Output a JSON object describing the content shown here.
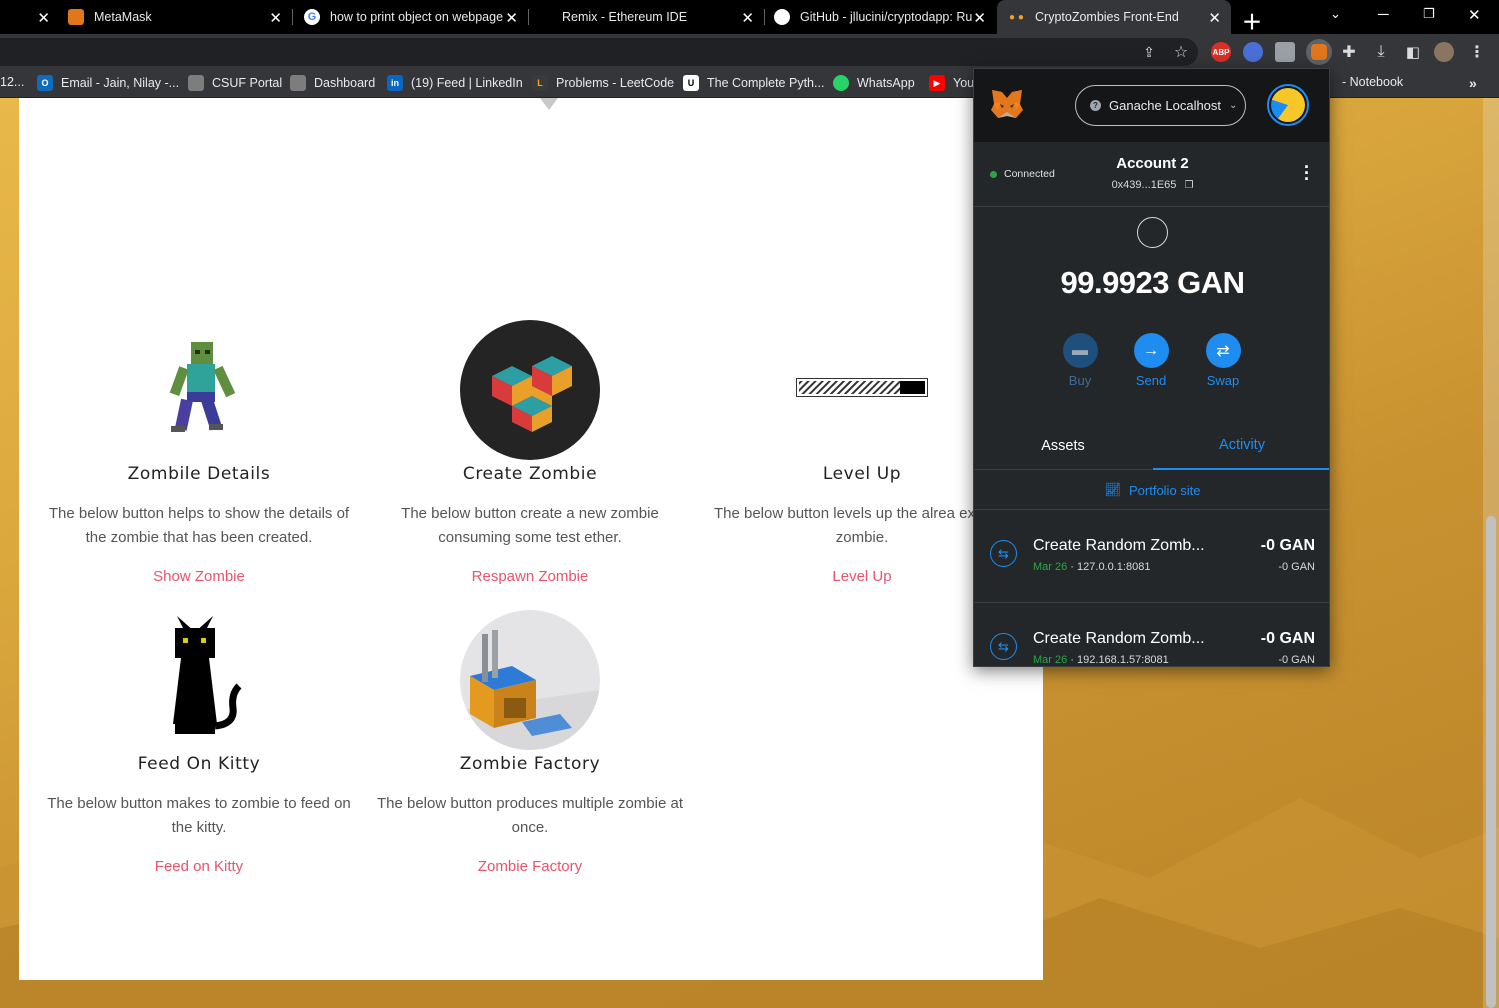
{
  "tabs": [
    {
      "title": "MetaMask",
      "active": false
    },
    {
      "title": "how to print object on webpage",
      "active": false
    },
    {
      "title": "Remix - Ethereum IDE",
      "active": false
    },
    {
      "title": "GitHub - jllucini/cryptodapp: Ru",
      "active": false
    },
    {
      "title": "CryptoZombies Front-End",
      "active": true
    }
  ],
  "bookmarks": [
    {
      "label": "12...",
      "icon": "bookmark-icon"
    },
    {
      "label": "Email - Jain, Nilay -...",
      "icon": "outlook-icon"
    },
    {
      "label": "CSUF Portal",
      "icon": "csuf-icon"
    },
    {
      "label": "Dashboard",
      "icon": "csuf-icon"
    },
    {
      "label": "(19) Feed | LinkedIn",
      "icon": "linkedin-icon"
    },
    {
      "label": "Problems - LeetCode",
      "icon": "leetcode-icon"
    },
    {
      "label": "The Complete Pyth...",
      "icon": "udemy-icon"
    },
    {
      "label": "WhatsApp",
      "icon": "whatsapp-icon"
    },
    {
      "label": "You",
      "icon": "youtube-icon"
    },
    {
      "label": "- Notebook",
      "icon": "notebook-icon"
    }
  ],
  "features": [
    {
      "title": "Zombile Details",
      "desc": "The below button helps to show the details of the zombie that has been created.",
      "link": "Show Zombie"
    },
    {
      "title": "Create Zombie",
      "desc": "The below button create a new zombie consuming some test ether.",
      "link": "Respawn Zombie"
    },
    {
      "title": "Level Up",
      "desc": "The below button levels up the alrea existing zombie.",
      "link": "Level Up"
    },
    {
      "title": "Feed On Kitty",
      "desc": "The below button makes to zombie to feed on the kitty.",
      "link": "Feed on Kitty"
    },
    {
      "title": "Zombie Factory",
      "desc": "The below button produces multiple zombie at once.",
      "link": "Zombie Factory"
    }
  ],
  "metamask": {
    "network": "Ganache Localhost",
    "network_icon": "?",
    "status": "Connected",
    "account_name": "Account 2",
    "account_address": "0x439...1E65",
    "balance": "99.9923 GAN",
    "actions": {
      "buy": "Buy",
      "send": "Send",
      "swap": "Swap"
    },
    "tabs": {
      "assets": "Assets",
      "activity": "Activity"
    },
    "portfolio_label": "Portfolio site",
    "transactions": [
      {
        "title": "Create Random Zomb...",
        "date": "Mar 26",
        "origin": "127.0.0.1:8081",
        "amount": "-0 GAN",
        "amount_sub": "-0 GAN"
      },
      {
        "title": "Create Random Zomb...",
        "date": "Mar 26",
        "origin": "192.168.1.57:8081",
        "amount": "-0 GAN",
        "amount_sub": "-0 GAN"
      }
    ],
    "colors": {
      "accent": "#1f8cf0",
      "success": "#28a745",
      "background": "#24272a"
    }
  },
  "colors": {
    "link": "#e8546b",
    "page_bg": "#d9a63c"
  }
}
